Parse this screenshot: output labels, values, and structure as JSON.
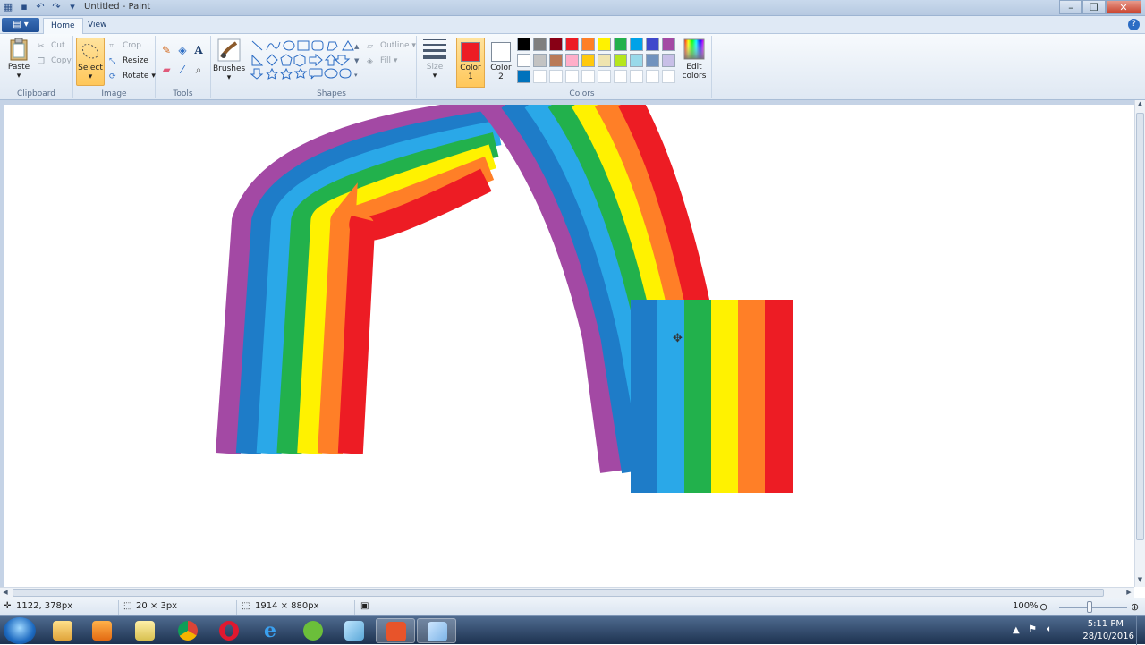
{
  "window": {
    "title": "Untitled - Paint"
  },
  "tabs": [
    {
      "label": "Home",
      "active": true
    },
    {
      "label": "View",
      "active": false
    }
  ],
  "ribbon": {
    "clipboard": {
      "label": "Clipboard",
      "paste": "Paste",
      "cut": "Cut",
      "copy": "Copy"
    },
    "image": {
      "label": "Image",
      "select": "Select",
      "crop": "Crop",
      "resize": "Resize",
      "rotate": "Rotate"
    },
    "tools": {
      "label": "Tools"
    },
    "brushes": {
      "label": "Brushes"
    },
    "shapes": {
      "label": "Shapes",
      "outline": "Outline",
      "fill": "Fill"
    },
    "size": {
      "label": "Size"
    },
    "colors": {
      "label": "Colors",
      "color1_label": "Color",
      "color1_num": "1",
      "color2_label": "Color",
      "color2_num": "2",
      "color1": "#ed1c24",
      "color2": "#ffffff",
      "edit_colors_line1": "Edit",
      "edit_colors_line2": "colors",
      "palette_row1": [
        "#000000",
        "#7f7f7f",
        "#880015",
        "#ed1c24",
        "#ff7f27",
        "#fff200",
        "#22b14c",
        "#00a2e8",
        "#3f48cc",
        "#a349a4"
      ],
      "palette_row2": [
        "#ffffff",
        "#c3c3c3",
        "#b97a57",
        "#ffaec9",
        "#ffc90e",
        "#efe4b0",
        "#b5e61d",
        "#99d9ea",
        "#7092be",
        "#c8bfe7"
      ],
      "palette_row3": [
        "#0072bc",
        "",
        "",
        "",
        "",
        "",
        "",
        "",
        "",
        ""
      ]
    }
  },
  "statusbar": {
    "cursor_pos": "1122, 378px",
    "selection_size": "20 × 3px",
    "image_size": "1914 × 880px",
    "zoom": "100%"
  },
  "taskbar": {
    "time": "5:11 PM",
    "date": "28/10/2016",
    "apps": [
      "windows-explorer",
      "media-player",
      "file-manager",
      "chrome",
      "opera",
      "internet-explorer",
      "utorrent",
      "notepad",
      "photo-app",
      "paint"
    ]
  },
  "drawing": {
    "stripe_colors": [
      "#a349a4",
      "#1e7cc8",
      "#2aa8e8",
      "#22b14c",
      "#fff200",
      "#ff7f27",
      "#ed1c24"
    ]
  }
}
